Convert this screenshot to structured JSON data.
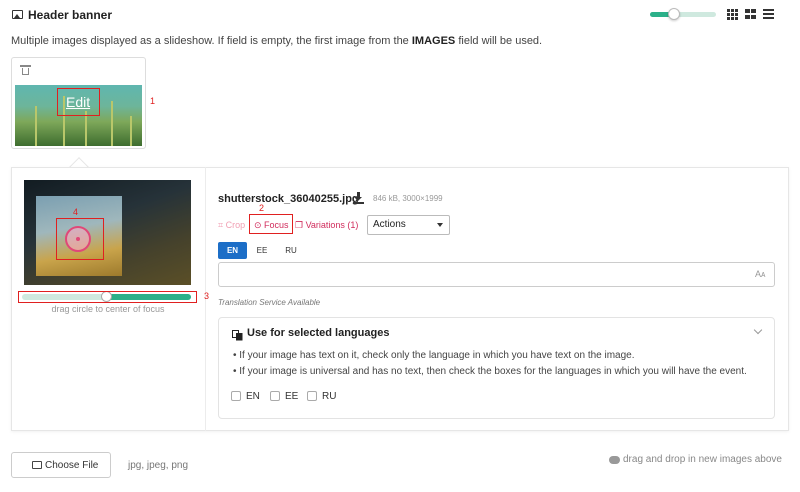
{
  "header": {
    "title": "Header banner",
    "title_icon": "image-icon",
    "view_icons": [
      "grid-small-icon",
      "grid-large-icon",
      "list-icon"
    ]
  },
  "description": {
    "before": "Multiple images displayed as a slideshow. If field is empty, the first image from the ",
    "bold": "IMAGES",
    "after": " field will be used."
  },
  "thumbnail": {
    "edit_label": "Edit",
    "annotation": "1"
  },
  "preview": {
    "focus_annotation": "4",
    "slider_annotation": "3",
    "zoom_level": 0.5,
    "hint": "drag circle to center of focus"
  },
  "file": {
    "name": "shutterstock_36040255.jpg",
    "meta": "846 kB, 3000×1999"
  },
  "tabs": {
    "crop": "Crop",
    "focus": "Focus",
    "focus_annotation": "2",
    "variations": "Variations (1)",
    "actions": "Actions"
  },
  "languages": {
    "tabs": [
      "EN",
      "EE",
      "RU"
    ],
    "active": "EN",
    "caption_value": "",
    "translation_note": "Translation Service Available"
  },
  "lang_card": {
    "title": "Use for selected languages",
    "bullets": [
      "• If your image has text on it, check only the language in which you have text on the image.",
      "• If your image is universal and has no text, then check the boxes for the languages in which you will have the event."
    ],
    "checkboxes": [
      {
        "label": "EN",
        "checked": false
      },
      {
        "label": "EE",
        "checked": false
      },
      {
        "label": "RU",
        "checked": false
      }
    ]
  },
  "footer": {
    "choose_file": "Choose File",
    "file_types": "jpg, jpeg, png",
    "drag_drop": "drag and drop in new images above"
  },
  "colors": {
    "accent_green": "#2bb089",
    "accent_pink": "#d12c5c",
    "active_lang_blue": "#1c6ec7",
    "annotation_red": "#e02020"
  }
}
